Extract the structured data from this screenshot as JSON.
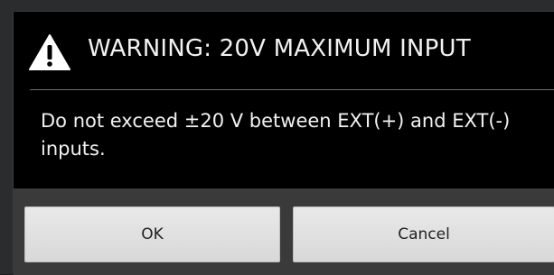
{
  "dialog": {
    "title": "WARNING: 20V MAXIMUM INPUT",
    "icon": "warning-icon",
    "message": "Do not exceed ±20 V between EXT(+) and EXT(-) inputs."
  },
  "buttons": {
    "ok_label": "OK",
    "cancel_label": "Cancel"
  },
  "colors": {
    "dialog_bg": "#000000",
    "button_bg": "#e0e0e0",
    "text": "#f2f2f2"
  }
}
